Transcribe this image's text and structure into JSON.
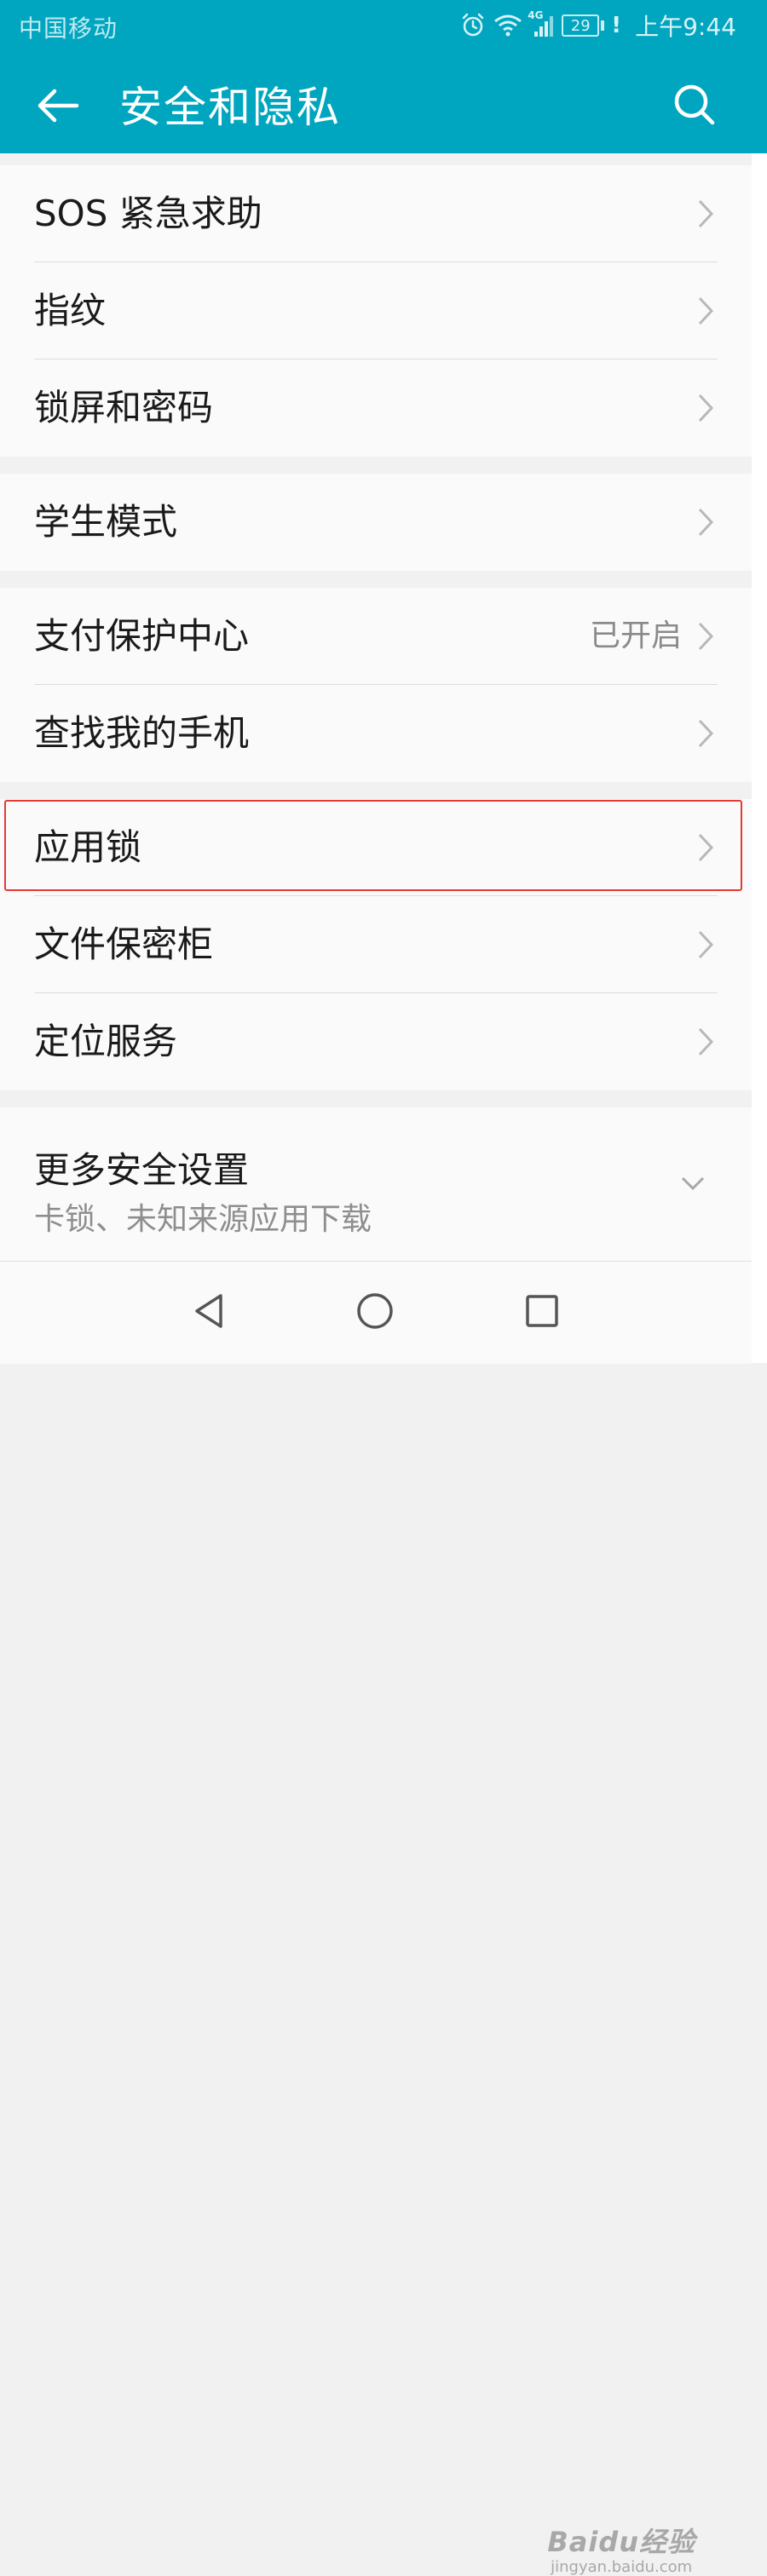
{
  "status_bar": {
    "carrier": "中国移动",
    "network": "4G",
    "battery": "29",
    "alert": "!",
    "time": "上午9:44"
  },
  "header": {
    "title": "安全和隐私",
    "back_icon": "arrow-left-icon",
    "search_icon": "search-icon",
    "background_color": "#00a6c0"
  },
  "groups": [
    {
      "items": [
        {
          "label": "SOS 紧急求助"
        },
        {
          "label": "指纹"
        },
        {
          "label": "锁屏和密码"
        }
      ]
    },
    {
      "items": [
        {
          "label": "学生模式"
        }
      ]
    },
    {
      "items": [
        {
          "label": "支付保护中心",
          "value": "已开启"
        },
        {
          "label": "查找我的手机"
        }
      ]
    },
    {
      "items": [
        {
          "label": "应用锁",
          "highlighted": true
        },
        {
          "label": "文件保密柜"
        },
        {
          "label": "定位服务"
        }
      ]
    },
    {
      "items": [
        {
          "label": "更多安全设置",
          "sublabel": "卡锁、未知来源应用下载",
          "expandable": true
        }
      ]
    }
  ],
  "nav_bar": {
    "back_icon": "triangle-back-icon",
    "home_icon": "circle-home-icon",
    "recents_icon": "square-recents-icon"
  },
  "watermark": {
    "main": "Baidu经验",
    "sub": "jingyan.baidu.com"
  },
  "colors": {
    "accent": "#00a6c0",
    "highlight_border": "#e53935"
  }
}
